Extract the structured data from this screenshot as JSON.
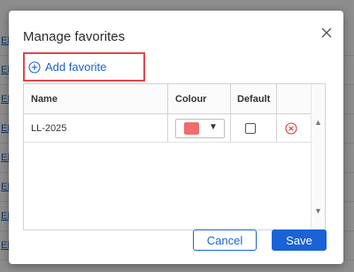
{
  "background": {
    "left_links": [
      "ED",
      "ED",
      "ED",
      "ED",
      "ED",
      "ED",
      "ED",
      "EM"
    ],
    "right_cells": [
      "Uni",
      "Uni",
      "Uni",
      "Uni",
      "Uni",
      "Uni",
      "Uni",
      "Uni"
    ]
  },
  "dialog": {
    "title": "Manage favorites",
    "close_icon": "close-icon",
    "add_favorite": {
      "label": "Add favorite",
      "icon": "plus-circle-icon",
      "highlight_color": "#e34747"
    },
    "table": {
      "columns": [
        "Name",
        "Colour",
        "Default"
      ],
      "rows": [
        {
          "name": "LL-2025",
          "colour": "#f26b6b",
          "default": false,
          "remove_icon": "remove-circle-icon"
        }
      ]
    },
    "buttons": {
      "cancel": "Cancel",
      "save": "Save"
    },
    "accent_color": "#1a62d6"
  }
}
